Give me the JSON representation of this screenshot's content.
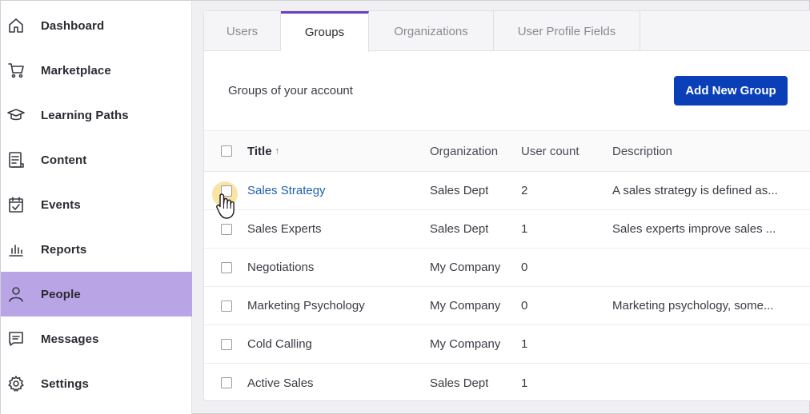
{
  "sidebar": {
    "items": [
      {
        "label": "Dashboard",
        "icon": "home-icon"
      },
      {
        "label": "Marketplace",
        "icon": "cart-icon"
      },
      {
        "label": "Learning Paths",
        "icon": "graduation-cap-icon"
      },
      {
        "label": "Content",
        "icon": "document-icon"
      },
      {
        "label": "Events",
        "icon": "calendar-check-icon"
      },
      {
        "label": "Reports",
        "icon": "bar-chart-icon"
      },
      {
        "label": "People",
        "icon": "person-icon",
        "active": true
      },
      {
        "label": "Messages",
        "icon": "message-icon"
      },
      {
        "label": "Settings",
        "icon": "gear-icon"
      }
    ],
    "active_color": "#b9a5e6"
  },
  "tabs": [
    {
      "label": "Users"
    },
    {
      "label": "Groups",
      "active": true
    },
    {
      "label": "Organizations"
    },
    {
      "label": "User Profile Fields"
    }
  ],
  "main": {
    "subheader": "Groups of your account",
    "add_button": "Add New Group",
    "accent_color": "#0a3fb8"
  },
  "table": {
    "headers": {
      "title": "Title",
      "title_sort": "↑",
      "organization": "Organization",
      "user_count": "User count",
      "description": "Description"
    },
    "rows": [
      {
        "title": "Sales Strategy",
        "organization": "Sales Dept",
        "user_count": "2",
        "description": "A sales strategy is defined as..."
      },
      {
        "title": "Sales Experts",
        "organization": "Sales Dept",
        "user_count": "1",
        "description": "Sales experts improve sales ..."
      },
      {
        "title": "Negotiations",
        "organization": "My Company",
        "user_count": "0",
        "description": ""
      },
      {
        "title": "Marketing Psychology",
        "organization": "My Company",
        "user_count": "0",
        "description": "Marketing psychology, some..."
      },
      {
        "title": "Cold Calling",
        "organization": "My Company",
        "user_count": "1",
        "description": ""
      },
      {
        "title": "Active Sales",
        "organization": "Sales Dept",
        "user_count": "1",
        "description": ""
      }
    ]
  }
}
